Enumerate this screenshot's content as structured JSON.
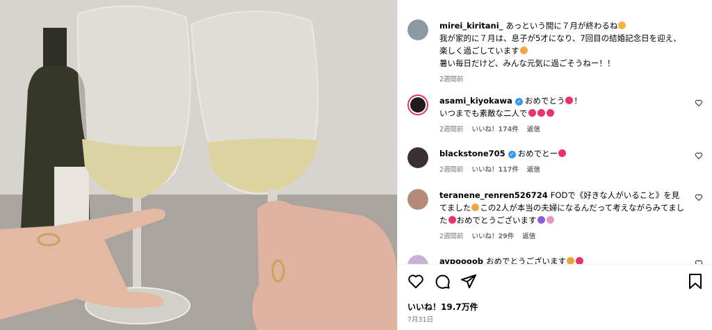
{
  "post": {
    "caption_user": "mirei_kiritani_",
    "caption_line1": "あっという間に７月が終わるね",
    "caption_line2": "我が家的に７月は、息子が5才になり、7回目の結婚記念日を迎え、楽しく過ごしています",
    "caption_line3": "暑い毎日だけど、みんな元気に過ごそうねー！！",
    "caption_time": "2週間前"
  },
  "comments": [
    {
      "user": "asami_kiyokawa",
      "verified": true,
      "text1": "おめでとう",
      "text1_suffix": "！",
      "text2": "いつまでも素敵な二人で",
      "time": "2週間前",
      "likes": "いいね！174件",
      "reply": "返信"
    },
    {
      "user": "blackstone705",
      "verified": true,
      "text1": "おめでとー",
      "time": "2週間前",
      "likes": "いいね！117件",
      "reply": "返信"
    },
    {
      "user": "teranene_renren526724",
      "verified": false,
      "text1": "FODで《好きな人がいること》を見てました",
      "text2": "この2人が本当の夫婦になるんだって考えながらみてました",
      "text3": "おめでとうございます",
      "time": "2週間前",
      "likes": "いいね！29件",
      "reply": "返信"
    },
    {
      "user": "aypoooob",
      "verified": false,
      "text1": "おめでとうございます"
    }
  ],
  "footer": {
    "likes": "いいね！19.7万件",
    "date": "7月31日"
  },
  "colors": {
    "verified": "#3897f0",
    "heart_emoji": "#e8336d",
    "meta": "#737373",
    "story_ring": "#e1306c"
  },
  "icons": [
    "heart-icon",
    "comment-icon",
    "share-icon",
    "bookmark-icon",
    "verified-badge-icon",
    "sun-emoji",
    "heart-eyes-emoji"
  ]
}
